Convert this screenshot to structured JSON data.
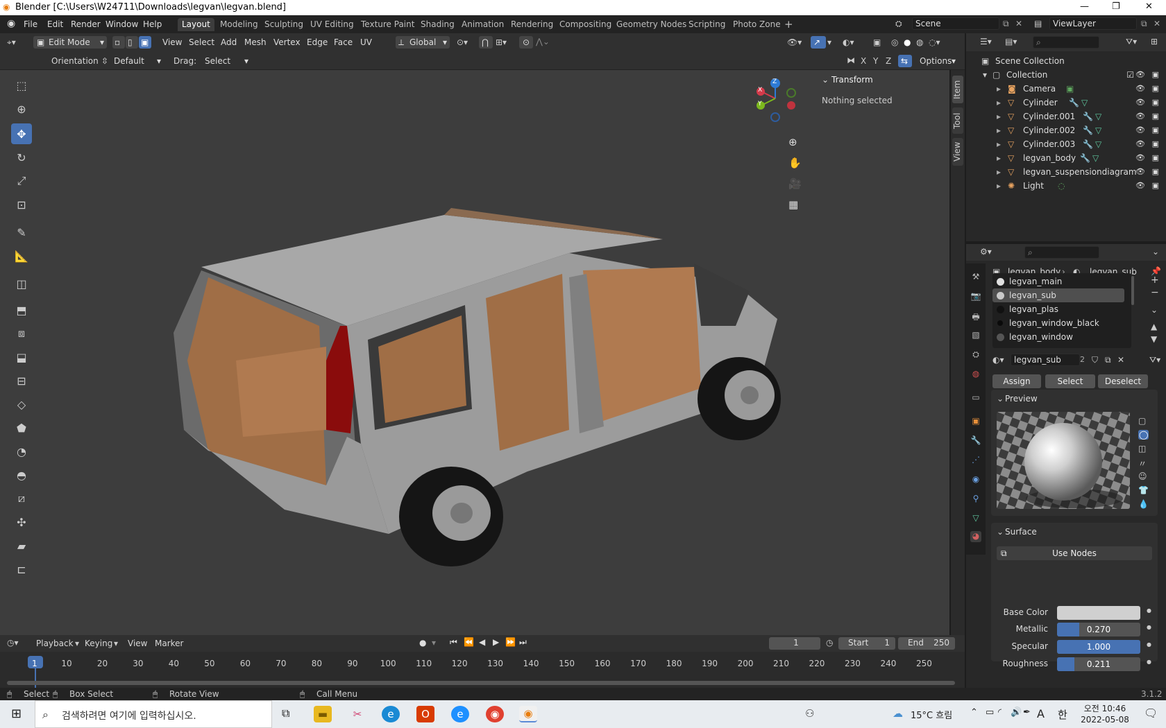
{
  "window": {
    "title": "Blender [C:\\Users\\W24711\\Downloads\\legvan\\legvan.blend]"
  },
  "menus": [
    "File",
    "Edit",
    "Render",
    "Window",
    "Help"
  ],
  "workspaces": [
    "Layout",
    "Modeling",
    "Sculpting",
    "UV Editing",
    "Texture Paint",
    "Shading",
    "Animation",
    "Rendering",
    "Compositing",
    "Geometry Nodes",
    "Scripting",
    "Photo Zone"
  ],
  "active_workspace": "Layout",
  "scene": "Scene",
  "view_layer": "ViewLayer",
  "viewport_header": {
    "mode": "Edit Mode",
    "menus": [
      "View",
      "Select",
      "Add",
      "Mesh",
      "Vertex",
      "Edge",
      "Face",
      "UV"
    ],
    "transform_orientation": "Global"
  },
  "tool_settings": {
    "orientation_label": "Orientation:",
    "orientation_value": "Default",
    "drag_label": "Drag:",
    "drag_value": "Select Box",
    "axes": [
      "X",
      "Y",
      "Z"
    ],
    "options": "Options"
  },
  "gizmo": {
    "x": "X",
    "y": "Y",
    "z": "Z"
  },
  "npanel": {
    "tabs": [
      "Item",
      "Tool",
      "View"
    ],
    "section": "Transform",
    "status": "Nothing selected"
  },
  "outliner": {
    "root": "Scene Collection",
    "collection": "Collection",
    "items": [
      "Camera",
      "Cylinder",
      "Cylinder.001",
      "Cylinder.002",
      "Cylinder.003",
      "legvan_body",
      "legvan_suspensiondiagram",
      "Light"
    ]
  },
  "properties": {
    "breadcrumb_object": "legvan_body",
    "breadcrumb_material": "legvan_sub",
    "slots": [
      {
        "name": "legvan_main",
        "color": "#e0e0e0"
      },
      {
        "name": "legvan_sub",
        "color": "#c8c8c8"
      },
      {
        "name": "legvan_plas",
        "color": "#111111"
      },
      {
        "name": "legvan_window_black",
        "color": "#0a0a0a"
      },
      {
        "name": "legvan_window",
        "color": "#555555"
      }
    ],
    "active_slot": "legvan_sub",
    "material_name": "legvan_sub",
    "users": "2",
    "buttons": [
      "Assign",
      "Select",
      "Deselect"
    ],
    "preview_label": "Preview",
    "surface_label": "Surface",
    "use_nodes": "Use Nodes",
    "fields": [
      {
        "label": "Base Color",
        "value": "",
        "fraction": 1.0,
        "color": "#d0d0d0"
      },
      {
        "label": "Metallic",
        "value": "0.270",
        "fraction": 0.27
      },
      {
        "label": "Specular",
        "value": "1.000",
        "fraction": 1.0
      },
      {
        "label": "Roughness",
        "value": "0.211",
        "fraction": 0.211
      }
    ]
  },
  "timeline": {
    "menus": [
      "Playback",
      "Keying",
      "View",
      "Marker"
    ],
    "current_frame": "1",
    "start_label": "Start",
    "start": "1",
    "end_label": "End",
    "end": "250",
    "ticks": [
      "1",
      "10",
      "20",
      "30",
      "40",
      "50",
      "60",
      "70",
      "80",
      "90",
      "100",
      "110",
      "120",
      "130",
      "140",
      "150",
      "160",
      "170",
      "180",
      "190",
      "200",
      "210",
      "220",
      "230",
      "240",
      "250"
    ]
  },
  "statusbar": {
    "select": "Select",
    "box_select": "Box Select",
    "rotate_view": "Rotate View",
    "call_menu": "Call Menu",
    "version": "3.1.2"
  },
  "taskbar": {
    "search_placeholder": "검색하려면 여기에 입력하십시오.",
    "weather": "15°C 흐림",
    "ime": "A",
    "ime2": "한",
    "time": "오전 10:46",
    "date": "2022-05-08"
  }
}
